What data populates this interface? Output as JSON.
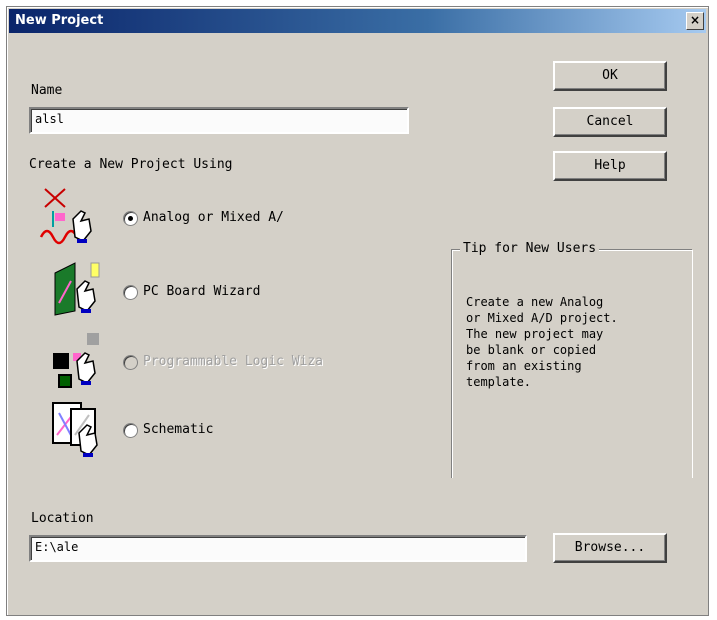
{
  "window": {
    "title": "New Project",
    "close_glyph": "×"
  },
  "name": {
    "label": "Name",
    "value": "alsl"
  },
  "create_group": {
    "title": "Create a New Project Using",
    "options": [
      {
        "label": "Analog or Mixed A/",
        "selected": true,
        "enabled": true,
        "icon": "analog-project-icon"
      },
      {
        "label": "PC Board Wizard",
        "selected": false,
        "enabled": true,
        "icon": "pc-board-icon"
      },
      {
        "label": "Programmable Logic Wiza",
        "selected": false,
        "enabled": false,
        "icon": "programmable-logic-icon"
      },
      {
        "label": "Schematic",
        "selected": false,
        "enabled": true,
        "icon": "schematic-icon"
      }
    ]
  },
  "buttons": {
    "ok": "OK",
    "cancel": "Cancel",
    "help": "Help",
    "browse": "Browse..."
  },
  "tip": {
    "title": "Tip for New Users",
    "text": "Create a new Analog\nor Mixed A/D project.\n The new project may\nbe blank or copied\nfrom an existing\ntemplate."
  },
  "location": {
    "label": "Location",
    "value": "E:\\ale"
  },
  "colors": {
    "dialog_bg": "#d4d0c8",
    "titlebar": "#0a246a"
  }
}
